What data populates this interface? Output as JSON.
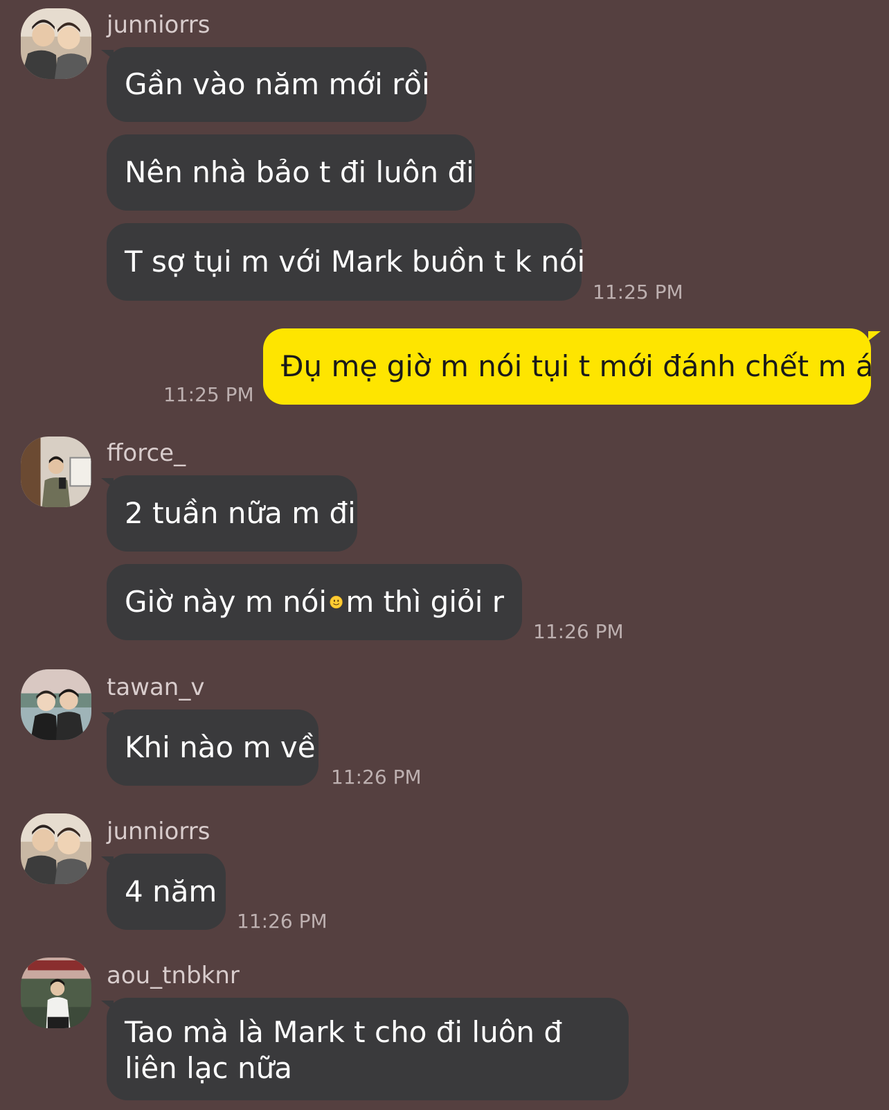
{
  "messages": [
    {
      "sender": "junniorrs",
      "text": "Gần vào năm mới rồi"
    },
    {
      "text": "Nên nhà bảo t đi luôn đi"
    },
    {
      "text": "T sợ tụi m với Mark buồn t k nói",
      "time": "11:25 PM"
    },
    {
      "self": true,
      "text": "Đụ mẹ giờ m nói tụi t mới đánh chết m á",
      "time": "11:25 PM"
    },
    {
      "sender": "fforce_",
      "text": "2 tuần nữa m đi"
    },
    {
      "text_before": "Giờ này m nói",
      "emoji": "slightly-smiling-face-icon",
      "text_after": "m thì giỏi r",
      "time": "11:26 PM"
    },
    {
      "sender": "tawan_v",
      "text": "Khi nào m về",
      "time": "11:26 PM"
    },
    {
      "sender": "junniorrs",
      "text": "4 năm",
      "time": "11:26 PM"
    },
    {
      "sender": "aou_tnbknr",
      "text": "Tao mà là Mark t cho đi luôn đ liên lạc nữa"
    }
  ]
}
